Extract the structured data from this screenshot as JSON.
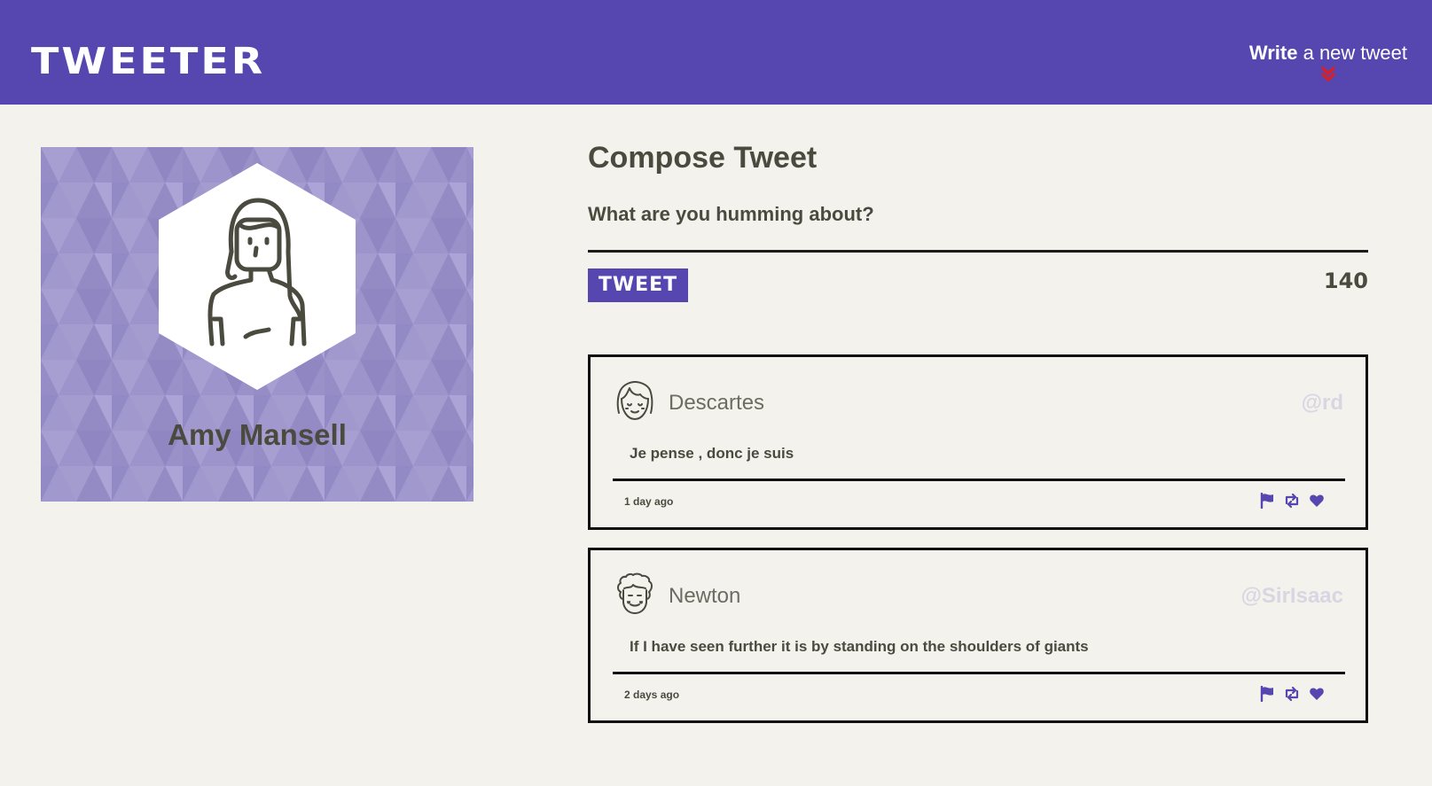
{
  "nav": {
    "brand": "TWEETER",
    "toggle_bold": "Write",
    "toggle_rest": " a new tweet",
    "toggle_icon": "double-chevron-down-icon"
  },
  "profile": {
    "name": "Amy Mansell",
    "avatar_icon": "woman-avatar-icon"
  },
  "compose": {
    "title": "Compose Tweet",
    "placeholder": "What are you humming about?",
    "button_label": "TWEET",
    "counter": "140"
  },
  "tweets": [
    {
      "name": "Descartes",
      "handle": "@rd",
      "content": "Je pense , donc je suis",
      "time": "1 day ago",
      "avatar_icon": "girl-face-avatar-icon"
    },
    {
      "name": "Newton",
      "handle": "@SirIsaac",
      "content": "If I have seen further it is by standing on the shoulders of giants",
      "time": "2 days ago",
      "avatar_icon": "curly-hair-face-avatar-icon"
    }
  ],
  "colors": {
    "nav_bg": "#5546b0",
    "page_bg": "#f3f2ec",
    "accent": "#5546b0",
    "chevron": "#d4202a",
    "text": "#4a4a3f",
    "handle": "#d8d6e3",
    "profile_bg": "#9a91c9"
  },
  "action_icons": [
    "flag-icon",
    "retweet-icon",
    "heart-icon"
  ]
}
